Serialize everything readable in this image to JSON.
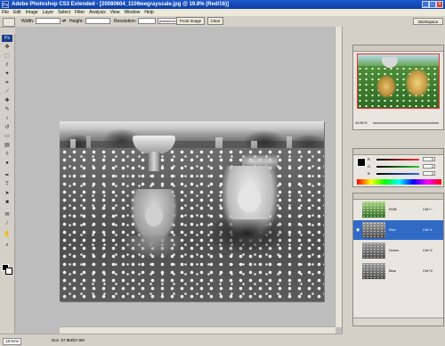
{
  "app": {
    "title": "Adobe Photoshop CS3 Extended - [20080604_1106wegrayscale.jpg @ 19.8% (Red/16)]",
    "badge": "Ps"
  },
  "menu": [
    "File",
    "Edit",
    "Image",
    "Layer",
    "Select",
    "Filter",
    "Analysis",
    "View",
    "Window",
    "Help"
  ],
  "options": {
    "width_label": "Width:",
    "height_label": "Height:",
    "resolution_label": "Resolution:",
    "unit_value": "pixels/inch",
    "front_image": "Front Image",
    "clear": "Clear",
    "workspace": "Workspace"
  },
  "toolbox": {
    "logo": "Ps",
    "tools": [
      "move-icon",
      "marquee-icon",
      "lasso-icon",
      "wand-icon",
      "crop-icon",
      "slice-icon",
      "heal-icon",
      "brush-icon",
      "stamp-icon",
      "history-brush-icon",
      "eraser-icon",
      "gradient-icon",
      "blur-icon",
      "dodge-icon",
      "pen-icon",
      "type-icon",
      "path-select-icon",
      "shape-icon",
      "notes-icon",
      "eyedropper-icon",
      "hand-icon",
      "zoom-icon"
    ]
  },
  "status": {
    "zoom": "19.81%",
    "doc": "Doc: 57.9M/57.9M"
  },
  "navigator": {
    "zoom": "19.81%"
  },
  "color_panel": {
    "rows": [
      {
        "label": "R",
        "value": "0",
        "bar": "#ff3333"
      },
      {
        "label": "G",
        "value": "0",
        "bar": "#33cc33"
      },
      {
        "label": "B",
        "value": "0",
        "bar": "#3366ff"
      }
    ]
  },
  "channels": [
    {
      "name": "RGB",
      "key": "Ctrl+~",
      "active": false
    },
    {
      "name": "Red",
      "key": "Ctrl+1",
      "active": true
    },
    {
      "name": "Green",
      "key": "Ctrl+2",
      "active": false
    },
    {
      "name": "Blue",
      "key": "Ctrl+3",
      "active": false
    }
  ]
}
